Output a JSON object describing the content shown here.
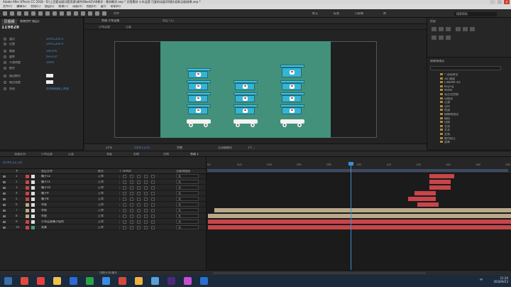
{
  "app": {
    "title": "Adobe After Effects CC 2018 - D:\\上百套动画\\3套资源\\课件\\Week5\\AE教学 - 素材教学.aep * 贝茜素材  小车运营 可爱的动画2D镜头相机动画效果.aep *",
    "window_controls": [
      "–",
      "□",
      "×"
    ]
  },
  "menu": [
    "文件(F)",
    "编辑(E)",
    "合成(C)",
    "图层(L)",
    "效果(T)",
    "动画(A)",
    "视图(V)",
    "窗口",
    "帮助(H)"
  ],
  "toolbar": {
    "snap": "对齐",
    "workspace": [
      "默认",
      "标准",
      "小屏幕",
      "库"
    ],
    "search": "搜索帮助"
  },
  "project": {
    "watermark": "贝视频",
    "watermark_id": "119828",
    "header": "效果控件 图层1",
    "rows": [
      {
        "label": "锚点",
        "value": "359.0,203.0"
      },
      {
        "label": "位置",
        "value": "359.0,203.0"
      },
      {
        "label": "缩放",
        "value": "100.0%"
      },
      {
        "label": "旋转",
        "value": "0x+0.0°"
      },
      {
        "label": "不透明度",
        "value": "100%"
      },
      {
        "label": "颜色",
        "value": ""
      },
      {
        "label": "描边颜色",
        "value": ""
      },
      {
        "label": "描边宽度",
        "value": "2.0"
      },
      {
        "label": "合成",
        "value": "在原始图像上合成"
      }
    ]
  },
  "comp": {
    "tabs": [
      "合成 小车运营",
      "图层 (无)"
    ],
    "breadcrumb": [
      "小车运营",
      "正面"
    ],
    "footer": {
      "zoom": "25%",
      "time": "0;00;11;25",
      "res": "完整",
      "camera": "活动摄像机",
      "views": "1个..."
    }
  },
  "right_panel": {
    "info_title": "信息",
    "effects_title": "效果和预设",
    "effects": [
      "* 动画预设",
      "3D 通道",
      "CINEMA 4D",
      "Keying",
      "Matte",
      "表达式控制",
      "风格化",
      "过渡",
      "过时",
      "绘画",
      "模糊和锐化",
      "模拟",
      "扭曲",
      "生成",
      "文本",
      "音频",
      "颜色校正",
      "遮罩"
    ]
  },
  "timeline": {
    "tabs": [
      "渲染队列",
      "小车运营",
      "正面",
      "背面",
      "右侧",
      "左侧",
      "合成 1"
    ],
    "timecode": "0;00;11;25",
    "columns": [
      "#",
      "图层名称",
      "模式",
      "T TrkMat",
      "父级和链接"
    ],
    "ticks": [
      "0s",
      "02s",
      "04s",
      "06s",
      "08s",
      "10s",
      "12s",
      "14s",
      "16s",
      "18s",
      "20s"
    ],
    "layers": [
      {
        "num": "1",
        "name": "箱子12",
        "mode": "正常",
        "parent": "无",
        "label": "#c8454a",
        "icon": "#dddddd"
      },
      {
        "num": "2",
        "name": "箱子11",
        "mode": "正常",
        "parent": "无",
        "label": "#c8454a",
        "icon": "#dddddd"
      },
      {
        "num": "3",
        "name": "箱子10",
        "mode": "正常",
        "parent": "无",
        "label": "#c8454a",
        "icon": "#dddddd"
      },
      {
        "num": "4",
        "name": "箱子9",
        "mode": "正常",
        "parent": "无",
        "label": "#c8454a",
        "icon": "#dddddd"
      },
      {
        "num": "5",
        "name": "箱子8",
        "mode": "正常",
        "parent": "无",
        "label": "#c8454a",
        "icon": "#dddddd"
      },
      {
        "num": "6",
        "name": "车轮",
        "mode": "正常",
        "parent": "无",
        "label": "#b8a98a",
        "icon": "#dddddd"
      },
      {
        "num": "7",
        "name": "车轮",
        "mode": "正常",
        "parent": "无",
        "label": "#b8a98a",
        "icon": "#dddddd"
      },
      {
        "num": "8",
        "name": "车轮",
        "mode": "正常",
        "parent": "无",
        "label": "#b8a98a",
        "icon": "#dddddd"
      },
      {
        "num": "9",
        "name": "小车运营箱子组合",
        "mode": "正常",
        "parent": "无",
        "label": "#c8454a",
        "icon": "#dddddd"
      },
      {
        "num": "10",
        "name": "背景",
        "mode": "正常",
        "parent": "无",
        "label": "#c8454a",
        "icon": "#3fa07f"
      }
    ],
    "bars": [
      {
        "row": 0,
        "start": 0.73,
        "end": 0.81,
        "color": "#c8454a"
      },
      {
        "row": 1,
        "start": 0.73,
        "end": 0.8,
        "color": "#c8454a"
      },
      {
        "row": 2,
        "start": 0.73,
        "end": 0.8,
        "color": "#c8454a"
      },
      {
        "row": 3,
        "start": 0.68,
        "end": 0.75,
        "color": "#c8454a"
      },
      {
        "row": 4,
        "start": 0.66,
        "end": 0.75,
        "color": "#c8454a"
      },
      {
        "row": 5,
        "start": 0.69,
        "end": 0.76,
        "color": "#c8454a"
      },
      {
        "row": 6,
        "start": 0.02,
        "end": 1.0,
        "color": "#b8a98a"
      },
      {
        "row": 7,
        "start": 0.0,
        "end": 1.0,
        "color": "#b8a98a"
      },
      {
        "row": 8,
        "start": 0.0,
        "end": 1.0,
        "color": "#c8454a"
      },
      {
        "row": 9,
        "start": 0.0,
        "end": 1.0,
        "color": "#c8454a"
      }
    ],
    "footer": "切换开关/模式"
  },
  "taskbar": {
    "apps": [
      "开始",
      "浏览器",
      "网易云",
      "资源管理器",
      "媒体播放器",
      "微信",
      "迅雷",
      "小说",
      "文件夹",
      "画图",
      "After Effects",
      "PR",
      "Photoshop"
    ],
    "clock": "21:20\n2018/9/23",
    "tray": "中"
  }
}
